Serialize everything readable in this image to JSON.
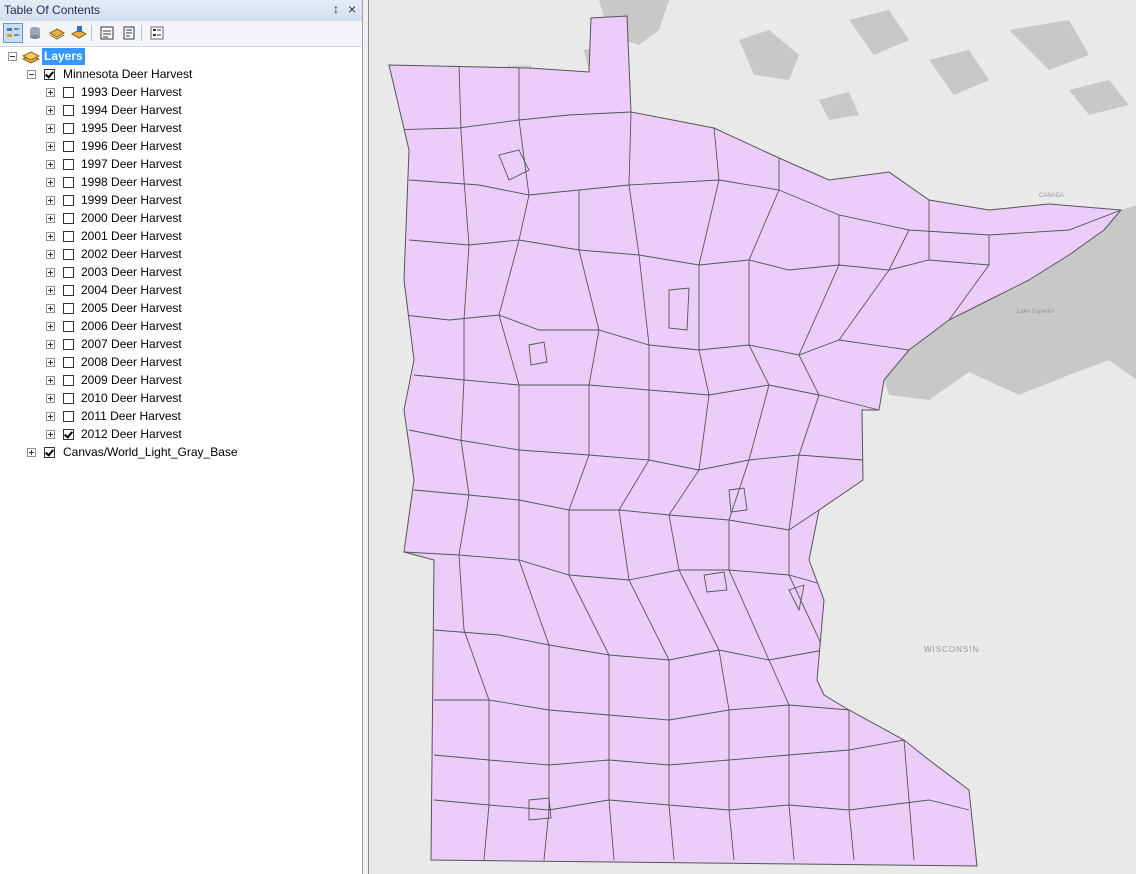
{
  "toc": {
    "title": "Table Of Contents",
    "pin_glyph": "↕",
    "close_glyph": "×",
    "toolbar": [
      {
        "icon": "list-by-drawing-order-icon",
        "active": true
      },
      {
        "icon": "list-by-source-icon",
        "active": false
      },
      {
        "icon": "list-by-visibility-icon",
        "active": false
      },
      {
        "icon": "list-by-selection-icon",
        "active": false
      },
      {
        "icon": "options-icon",
        "active": false
      },
      {
        "icon": "layer-properties-icon",
        "active": false
      },
      {
        "icon": "legend-options-icon",
        "active": false
      }
    ],
    "root": {
      "label": "Layers",
      "expanded": true
    },
    "group": {
      "label": "Minnesota Deer Harvest",
      "checked": true,
      "expanded": true
    },
    "layers": [
      {
        "label": "1993 Deer Harvest",
        "checked": false
      },
      {
        "label": "1994 Deer Harvest",
        "checked": false
      },
      {
        "label": "1995 Deer Harvest",
        "checked": false
      },
      {
        "label": "1996 Deer Harvest",
        "checked": false
      },
      {
        "label": "1997 Deer Harvest",
        "checked": false
      },
      {
        "label": "1998 Deer Harvest",
        "checked": false
      },
      {
        "label": "1999 Deer Harvest",
        "checked": false
      },
      {
        "label": "2000 Deer Harvest",
        "checked": false
      },
      {
        "label": "2001 Deer Harvest",
        "checked": false
      },
      {
        "label": "2002 Deer Harvest",
        "checked": false
      },
      {
        "label": "2003 Deer Harvest",
        "checked": false
      },
      {
        "label": "2004 Deer Harvest",
        "checked": false
      },
      {
        "label": "2005 Deer Harvest",
        "checked": false
      },
      {
        "label": "2006 Deer Harvest",
        "checked": false
      },
      {
        "label": "2007 Deer Harvest",
        "checked": false
      },
      {
        "label": "2008 Deer Harvest",
        "checked": false
      },
      {
        "label": "2009 Deer Harvest",
        "checked": false
      },
      {
        "label": "2010 Deer Harvest",
        "checked": false
      },
      {
        "label": "2011 Deer Harvest",
        "checked": false
      },
      {
        "label": "2012 Deer Harvest",
        "checked": true
      }
    ],
    "basemap": {
      "label": "Canvas/World_Light_Gray_Base",
      "checked": true
    }
  },
  "map": {
    "labels": {
      "canada_west": "CANADA",
      "canada_east": "CANADA",
      "lake": "Lake\nSuperior",
      "wisconsin": "WISCONSIN"
    },
    "colors": {
      "background": "#e9e9e9",
      "water": "#c8c8c8",
      "unit_fill": "#eccdfa",
      "unit_stroke": "#555555"
    }
  }
}
